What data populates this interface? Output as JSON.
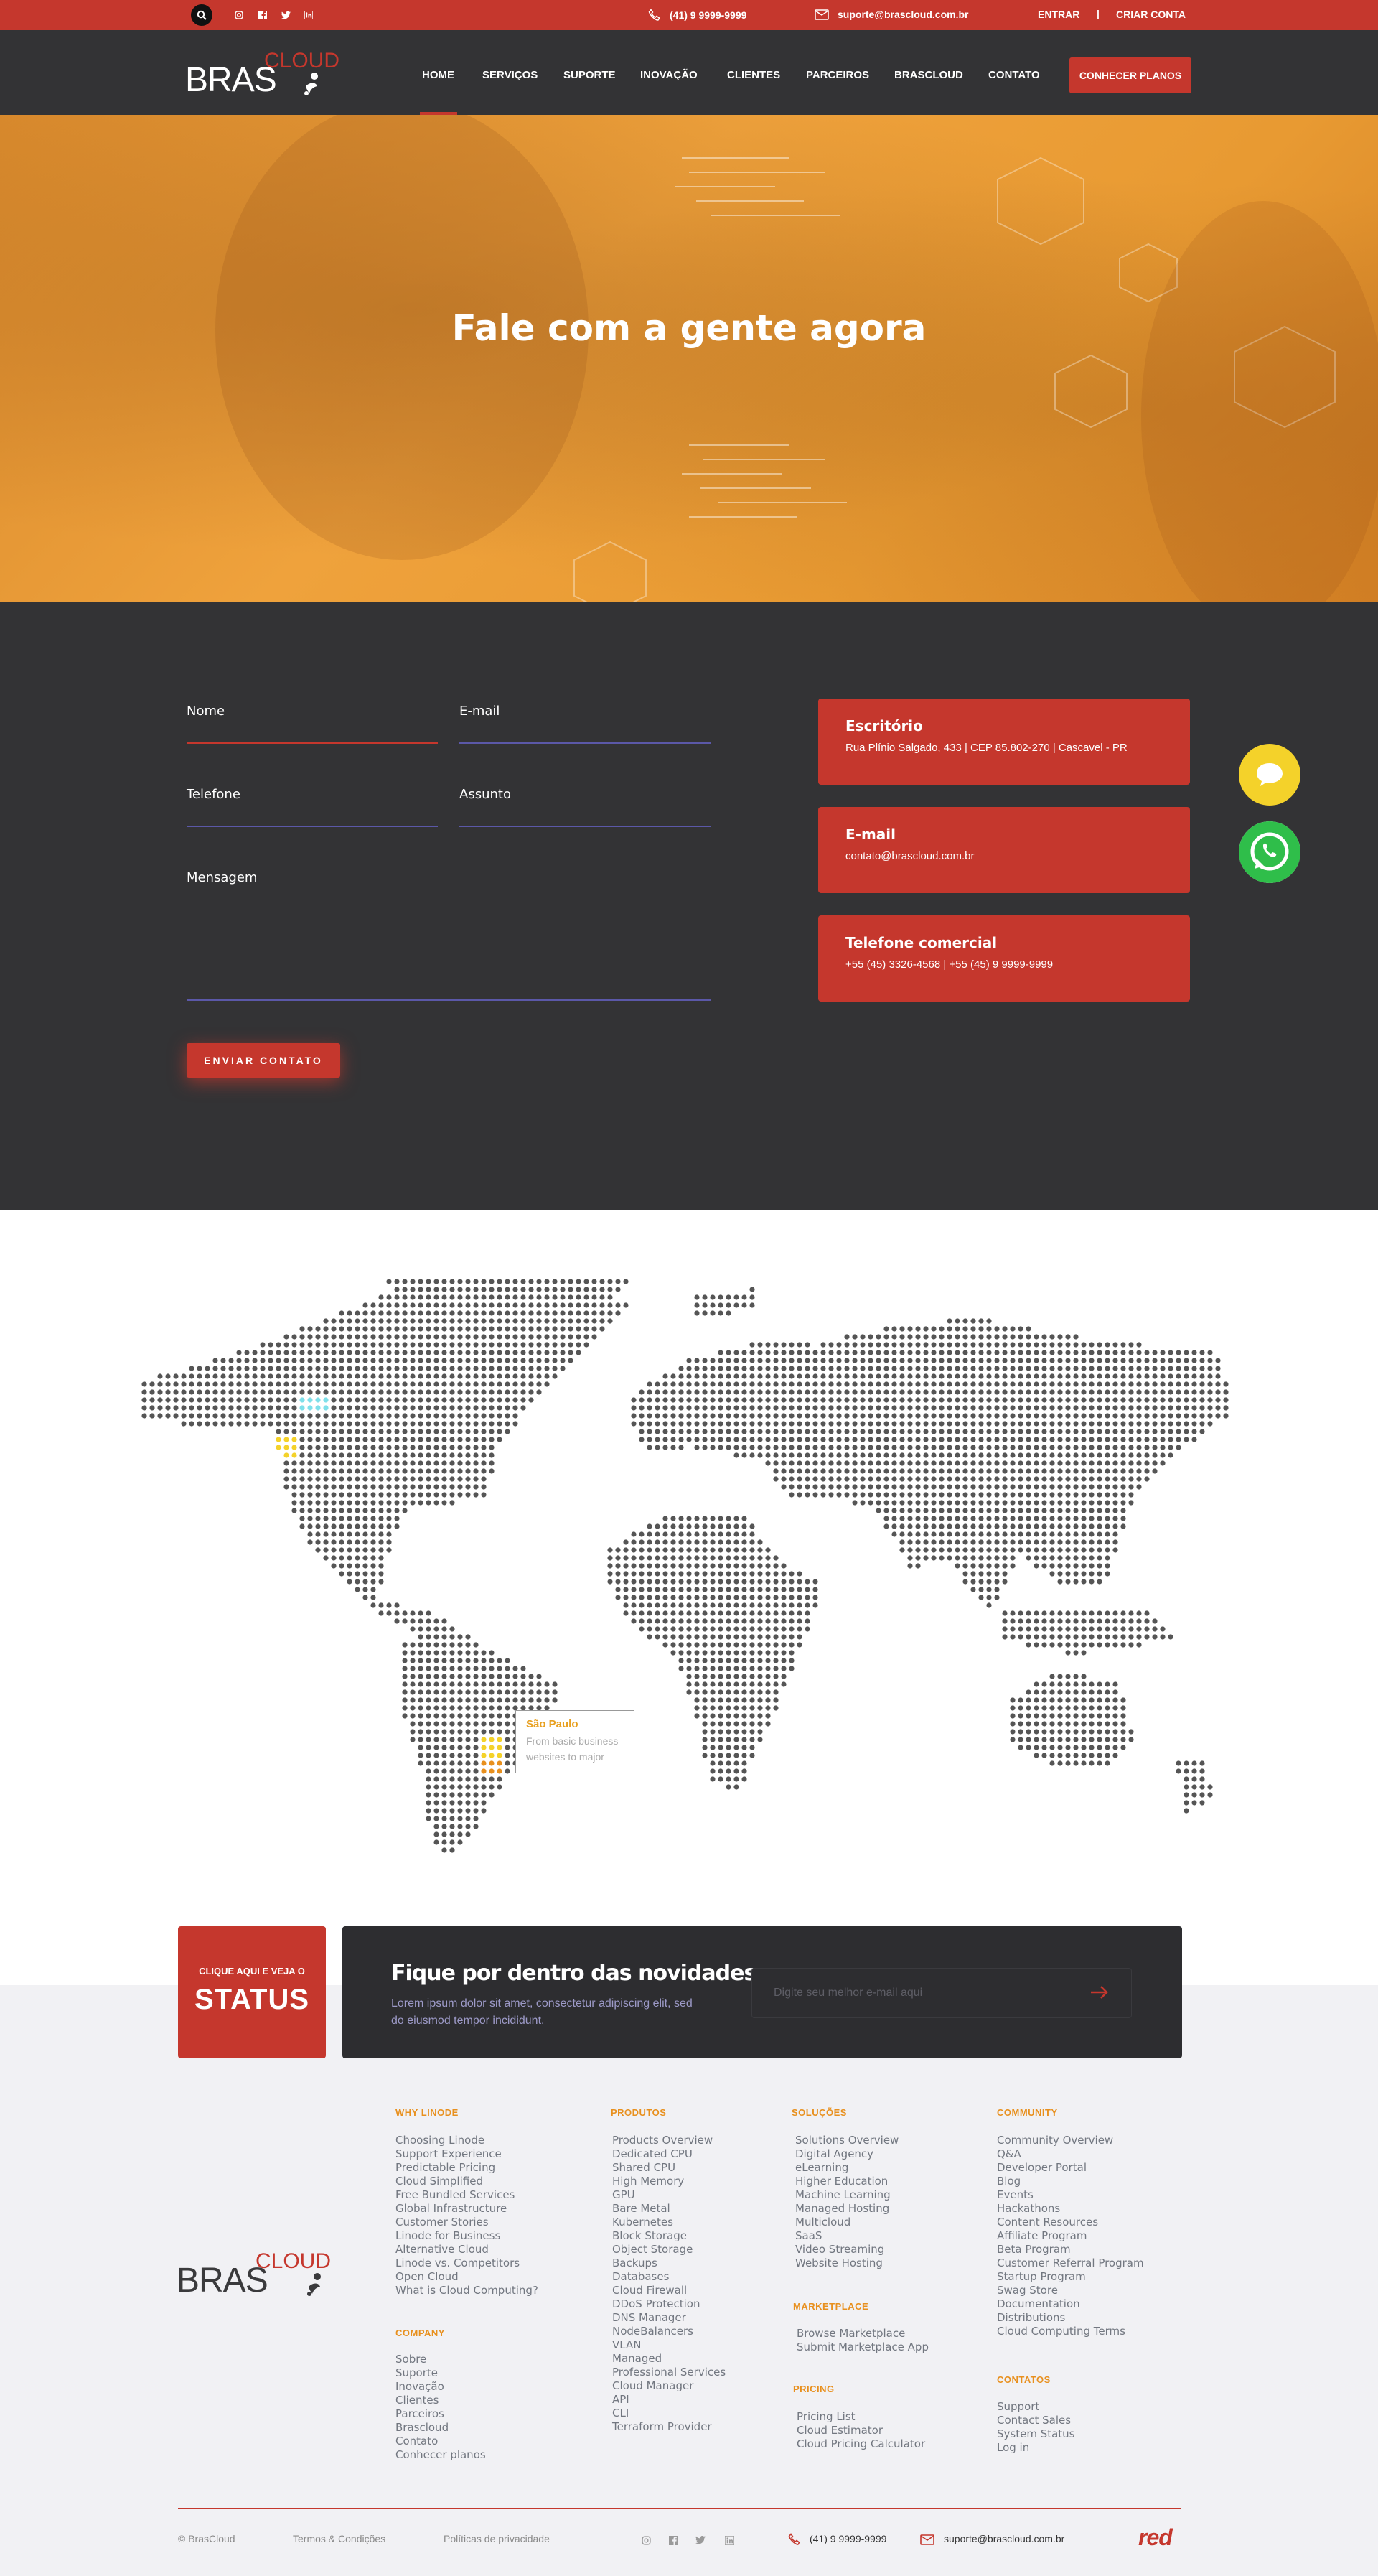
{
  "topbar": {
    "phone": "(41) 9 9999-9999",
    "email": "suporte@brascloud.com.br",
    "login": "ENTRAR",
    "separator": "|",
    "signup": "CRIAR CONTA",
    "icons": [
      "search-icon",
      "instagram-icon",
      "facebook-icon",
      "twitter-icon",
      "linkedin-icon"
    ]
  },
  "logo": {
    "bras": "BRAS",
    "cloud": "CLOUD"
  },
  "nav": {
    "items": [
      "HOME",
      "SERVIÇOS",
      "SUPORTE",
      "INOVAÇÃO",
      "CLIENTES",
      "PARCEIROS",
      "BRASCLOUD",
      "CONTATO"
    ],
    "active": "HOME",
    "cta": "CONHECER PLANOS"
  },
  "hero": {
    "title": "Fale com a gente agora"
  },
  "form": {
    "name": "Nome",
    "email": "E-mail",
    "phone": "Telefone",
    "subject": "Assunto",
    "message": "Mensagem",
    "submit": "ENVIAR CONTATO"
  },
  "cards": [
    {
      "title": "Escritório",
      "text": "Rua Plínio Salgado, 433 | CEP 85.802-270 | Cascavel - PR"
    },
    {
      "title": "E-mail",
      "text": "contato@brascloud.com.br"
    },
    {
      "title": "Telefone comercial",
      "text": "+55 (45) 3326-4568 | +55 (45) 9 9999-9999"
    }
  ],
  "map": {
    "tooltip_title": "São Paulo",
    "tooltip_text": "From basic business websites to major"
  },
  "status": {
    "line1": "CLIQUE AQUI E VEJA O",
    "line2": "STATUS"
  },
  "newsletter": {
    "title": "Fique por dentro das novidades",
    "text": "Lorem ipsum dolor sit amet, consectetur adipiscing elit, sed do eiusmod tempor incididunt.",
    "placeholder": "Digite seu melhor e-mail aqui"
  },
  "footer": {
    "why": {
      "title": "WHY LINODE",
      "items": [
        "Choosing Linode",
        "Support Experience",
        "Predictable Pricing",
        "Cloud Simplified",
        "Free Bundled Services",
        "Global Infrastructure",
        "Customer Stories",
        "Linode for Business",
        "Alternative Cloud",
        "Linode vs. Competitors",
        "Open Cloud",
        "What is Cloud Computing?"
      ]
    },
    "company": {
      "title": "COMPANY",
      "items": [
        "Sobre",
        "Suporte",
        "Inovação",
        "Clientes",
        "Parceiros",
        "Brascloud",
        "Contato",
        "Conhecer planos"
      ]
    },
    "products": {
      "title": "PRODUTOS",
      "items": [
        "Products Overview",
        "Dedicated CPU",
        "Shared CPU",
        "High Memory",
        "GPU",
        "Bare Metal",
        "Kubernetes",
        "Block Storage",
        "Object Storage",
        "Backups",
        "Databases",
        "Cloud Firewall",
        "DDoS Protection",
        "DNS Manager",
        "NodeBalancers",
        "VLAN",
        "Managed",
        "Professional Services",
        "Cloud Manager",
        "API",
        "CLI",
        "Terraform Provider"
      ]
    },
    "solutions": {
      "title": "SOLUÇÕES",
      "items": [
        "Solutions Overview",
        "Digital Agency",
        "eLearning",
        "Higher Education",
        "Machine Learning",
        "Managed Hosting",
        "Multicloud",
        "SaaS",
        "Video Streaming",
        "Website Hosting"
      ]
    },
    "marketplace": {
      "title": "MARKETPLACE",
      "items": [
        "Browse Marketplace",
        "Submit Marketplace App"
      ]
    },
    "pricing": {
      "title": "PRICING",
      "items": [
        "Pricing List",
        "Cloud Estimator",
        "Cloud Pricing Calculator"
      ]
    },
    "community": {
      "title": "COMMUNITY",
      "items": [
        "Community Overview",
        "Q&A",
        "Developer Portal",
        "Blog",
        "Events",
        "Hackathons",
        "Content Resources",
        "Affiliate Program",
        "Beta Program",
        "Customer Referral Program",
        "Startup Program",
        "Swag Store",
        "Documentation",
        "Distributions",
        "Cloud Computing Terms"
      ]
    },
    "contacts": {
      "title": "CONTATOS",
      "items": [
        "Support",
        "Contact Sales",
        "System Status",
        "Log in"
      ]
    }
  },
  "bottom": {
    "copyright": "© BrasCloud",
    "terms": "Termos & Condições",
    "privacy": "Políticas de privacidade",
    "phone": "(41) 9 9999-9999",
    "email": "suporte@brascloud.com.br",
    "brand": "red"
  },
  "colors": {
    "accent": "#c5372d",
    "dark": "#333335",
    "orange": "#e8901e",
    "hero": "#efa23c"
  }
}
